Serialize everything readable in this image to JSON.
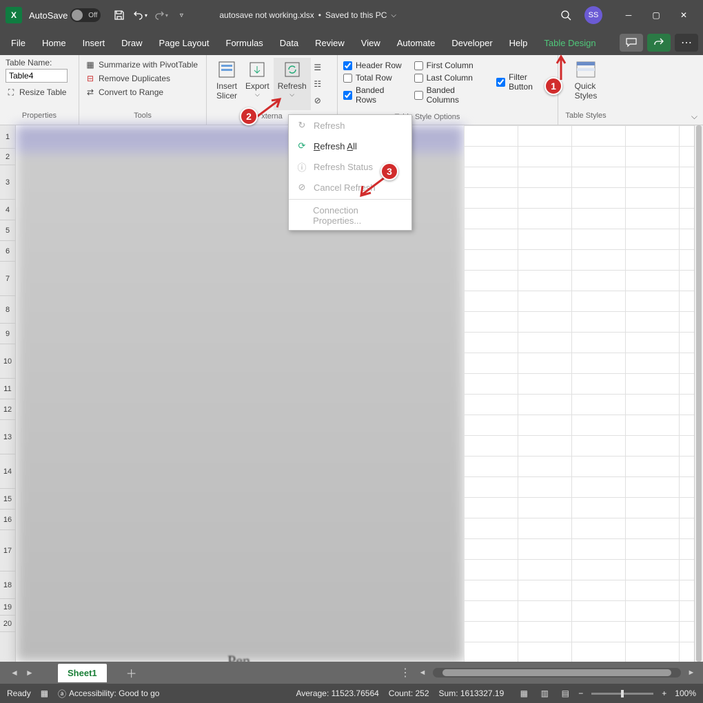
{
  "titlebar": {
    "autosave": "AutoSave",
    "toggle": "Off",
    "filename": "autosave not working.xlsx",
    "saved": "Saved to this PC",
    "avatar": "SS"
  },
  "menu": [
    "File",
    "Home",
    "Insert",
    "Draw",
    "Page Layout",
    "Formulas",
    "Data",
    "Review",
    "View",
    "Automate",
    "Developer",
    "Help",
    "Table Design"
  ],
  "ribbon": {
    "properties": {
      "label": "Properties",
      "tableNameLabel": "Table Name:",
      "tableName": "Table4",
      "resize": "Resize Table"
    },
    "tools": {
      "label": "Tools",
      "pivot": "Summarize with PivotTable",
      "dup": "Remove Duplicates",
      "convert": "Convert to Range"
    },
    "external": {
      "slicer": "Insert\nSlicer",
      "export": "Export",
      "refresh": "Refresh",
      "groupLabelLeft": "xterna"
    },
    "styleopts": {
      "label": "Table Style Options",
      "header": "Header Row",
      "total": "Total Row",
      "banded": "Banded Rows",
      "firstcol": "First Column",
      "lastcol": "Last Column",
      "bandedcol": "Banded Columns",
      "filter": "Filter Button"
    },
    "styles": {
      "label": "Table Styles",
      "quick": "Quick\nStyles"
    }
  },
  "dropdown": {
    "refresh": "Refresh",
    "refreshAll": "Refresh All",
    "status": "Refresh Status",
    "cancel": "Cancel Refresh",
    "connProps": "Connection Properties..."
  },
  "rows": [
    1,
    2,
    3,
    4,
    5,
    6,
    7,
    8,
    9,
    10,
    11,
    12,
    13,
    14,
    15,
    16,
    17,
    18,
    19,
    20
  ],
  "blurWord": "Pen",
  "tab": "Sheet1",
  "status": {
    "ready": "Ready",
    "access": "Accessibility: Good to go",
    "avg": "Average: 11523.76564",
    "count": "Count: 252",
    "sum": "Sum: 1613327.19",
    "zoom": "100%"
  },
  "callouts": {
    "c1": "1",
    "c2": "2",
    "c3": "3"
  }
}
